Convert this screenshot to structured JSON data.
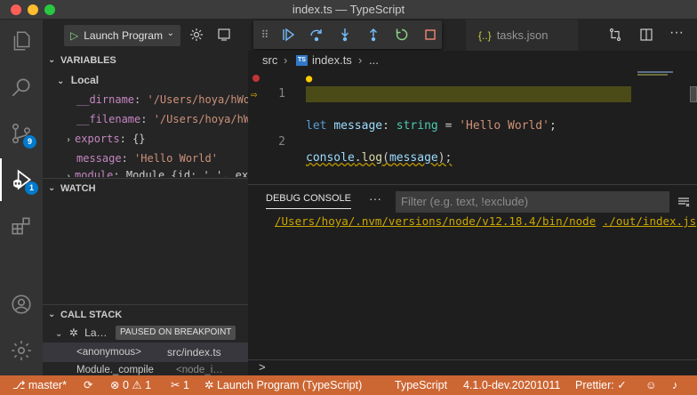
{
  "window": {
    "title": "index.ts — TypeScript"
  },
  "activity_bar": {
    "scm_badge": "9",
    "debug_badge": "1"
  },
  "debug": {
    "launch_config": "Launch Program"
  },
  "variables": {
    "header": "VARIABLES",
    "scope": "Local",
    "items": [
      {
        "name": "__dirname",
        "value": "'/Users/hoya/hWor…",
        "kind": "string"
      },
      {
        "name": "__filename",
        "value": "'/Users/hoya/hWo…",
        "kind": "string"
      },
      {
        "name": "exports",
        "value": "{}",
        "kind": "object"
      },
      {
        "name": "message",
        "value": "'Hello World'",
        "kind": "string"
      },
      {
        "name": "module",
        "value": "Module {id: '.', ext…",
        "kind": "object"
      }
    ]
  },
  "watch": {
    "header": "WATCH"
  },
  "call_stack": {
    "header": "CALL STACK",
    "thread_label": "La…",
    "paused_label": "PAUSED ON BREAKPOINT",
    "frames": [
      {
        "name": "<anonymous>",
        "source": "src/index.ts"
      },
      {
        "name": "Module._compile",
        "source": "<node_i…"
      }
    ]
  },
  "tabs": {
    "tasks_label": "tasks.json",
    "tasks_icon": "{..}"
  },
  "breadcrumb": {
    "folder": "src",
    "file": "index.ts",
    "ts_icon": "TS",
    "more": "..."
  },
  "editor": {
    "line_numbers": [
      "1",
      "2"
    ],
    "line1": {
      "kw": "let",
      "ident": "message",
      "colon": ":",
      "type": "string",
      "eq": "=",
      "str": "'Hello World'",
      "end": ";"
    },
    "line2": {
      "obj": "console",
      "dot": ".",
      "fn": "log",
      "open": "(",
      "arg": "message",
      "close": ");"
    }
  },
  "panel": {
    "tab_label": "DEBUG CONSOLE",
    "more": "···",
    "filter_placeholder": "Filter (e.g. text, !exclude)",
    "output_path": "/Users/hoya/.nvm/versions/node/v12.18.4/bin/node",
    "output_file": "./out/index.js",
    "prompt": ">"
  },
  "statusbar": {
    "branch": "master*",
    "errors": "0",
    "warnings": "1",
    "tasks": "1",
    "launch": "Launch Program (TypeScript)",
    "language": "TypeScript",
    "version": "4.1.0-dev.20201011",
    "prettier": "Prettier: ✓"
  },
  "colors": {
    "statusbar": "#cc6633",
    "accent": "#007acc",
    "current_line": "#4b4b18"
  }
}
